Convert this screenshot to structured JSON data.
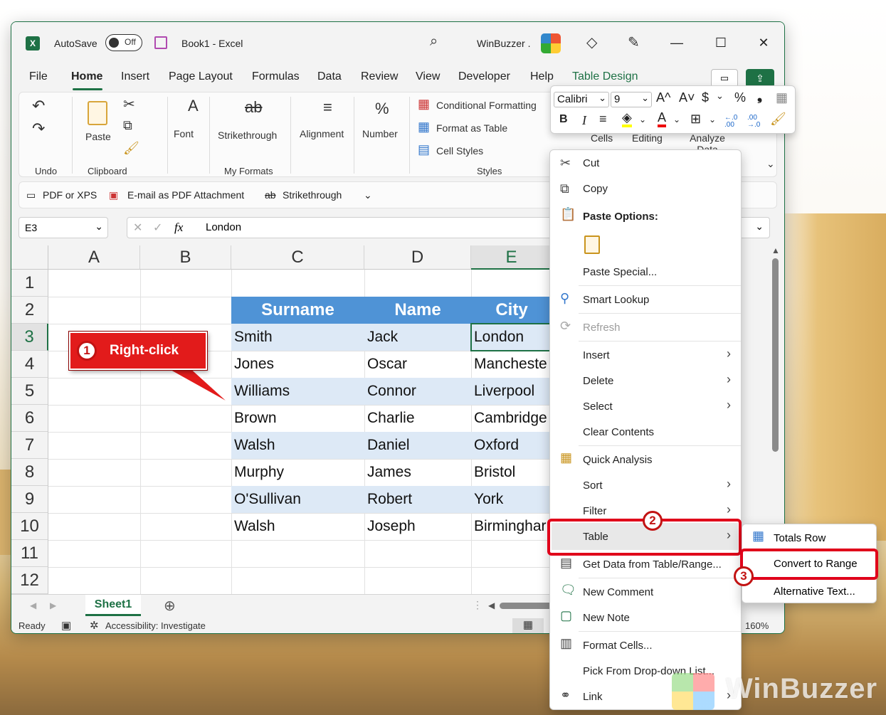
{
  "titlebar": {
    "autosave_label": "AutoSave",
    "autosave_state": "Off",
    "doc_title": "Book1  -  Excel",
    "account": "WinBuzzer ."
  },
  "menu": {
    "file": "File",
    "home": "Home",
    "insert": "Insert",
    "page_layout": "Page Layout",
    "formulas": "Formulas",
    "data": "Data",
    "review": "Review",
    "view": "View",
    "developer": "Developer",
    "help": "Help",
    "table_design": "Table Design"
  },
  "ribbon": {
    "undo_group": "Undo",
    "paste": "Paste",
    "clipboard_group": "Clipboard",
    "font": "Font",
    "strikethrough": "Strikethrough",
    "my_formats_group": "My Formats",
    "alignment": "Alignment",
    "number": "Number",
    "conditional_formatting": "Conditional Formatting",
    "format_as_table": "Format as Table",
    "cell_styles": "Cell Styles",
    "styles_group": "Styles",
    "cells": "Cells",
    "editing": "Editing",
    "analyze_data": "Analyze Data"
  },
  "qat": {
    "pdf_xps": "PDF or XPS",
    "email_pdf": "E-mail as PDF Attachment",
    "strikethrough": "Strikethrough"
  },
  "formula_bar": {
    "name_box": "E3",
    "fx": "fx",
    "value": "London"
  },
  "grid": {
    "columns": [
      "A",
      "B",
      "C",
      "D",
      "E"
    ],
    "rows": [
      "1",
      "2",
      "3",
      "4",
      "5",
      "6",
      "7",
      "8",
      "9",
      "10",
      "11",
      "12"
    ],
    "table_headers": [
      "Surname",
      "Name",
      "City"
    ],
    "table_rows": [
      [
        "Smith",
        "Jack",
        "London"
      ],
      [
        "Jones",
        "Oscar",
        "Mancheste"
      ],
      [
        "Williams",
        "Connor",
        "Liverpool"
      ],
      [
        "Brown",
        "Charlie",
        "Cambridge"
      ],
      [
        "Walsh",
        "Daniel",
        "Oxford"
      ],
      [
        "Murphy",
        "James",
        "Bristol"
      ],
      [
        "O'Sullivan",
        "Robert",
        "York"
      ],
      [
        "Walsh",
        "Joseph",
        "Birminghar"
      ]
    ]
  },
  "sheets": {
    "active": "Sheet1"
  },
  "status": {
    "ready": "Ready",
    "accessibility": "Accessibility: Investigate",
    "zoom": "160%"
  },
  "callouts": {
    "step1_num": "1",
    "step1_text": "Right-click",
    "step2_num": "2",
    "step3_num": "3"
  },
  "mini_toolbar": {
    "font": "Calibri",
    "size": "9",
    "bold": "B",
    "italic": "I",
    "percent": "%",
    "comma": "❟",
    "currency": "$",
    "dec_inc": "←.0 .00",
    "dec_dec": ".00 →.0"
  },
  "context_menu": {
    "cut": "Cut",
    "copy": "Copy",
    "paste_options": "Paste Options:",
    "paste_special": "Paste Special...",
    "smart_lookup": "Smart Lookup",
    "refresh": "Refresh",
    "insert": "Insert",
    "delete": "Delete",
    "select": "Select",
    "clear_contents": "Clear Contents",
    "quick_analysis": "Quick Analysis",
    "sort": "Sort",
    "filter": "Filter",
    "table": "Table",
    "get_data": "Get Data from Table/Range...",
    "new_comment": "New Comment",
    "new_note": "New Note",
    "format_cells": "Format Cells...",
    "pick_list": "Pick From Drop-down List...",
    "link": "Link"
  },
  "table_submenu": {
    "totals_row": "Totals Row",
    "convert_to_range": "Convert to Range",
    "alt_text": "Alternative Text..."
  },
  "watermark": "WinBuzzer",
  "colors": {
    "excel_green": "#1e7145",
    "table_header": "#4f93d6",
    "table_band": "#dde9f6",
    "callout_red": "#e21b1b"
  }
}
